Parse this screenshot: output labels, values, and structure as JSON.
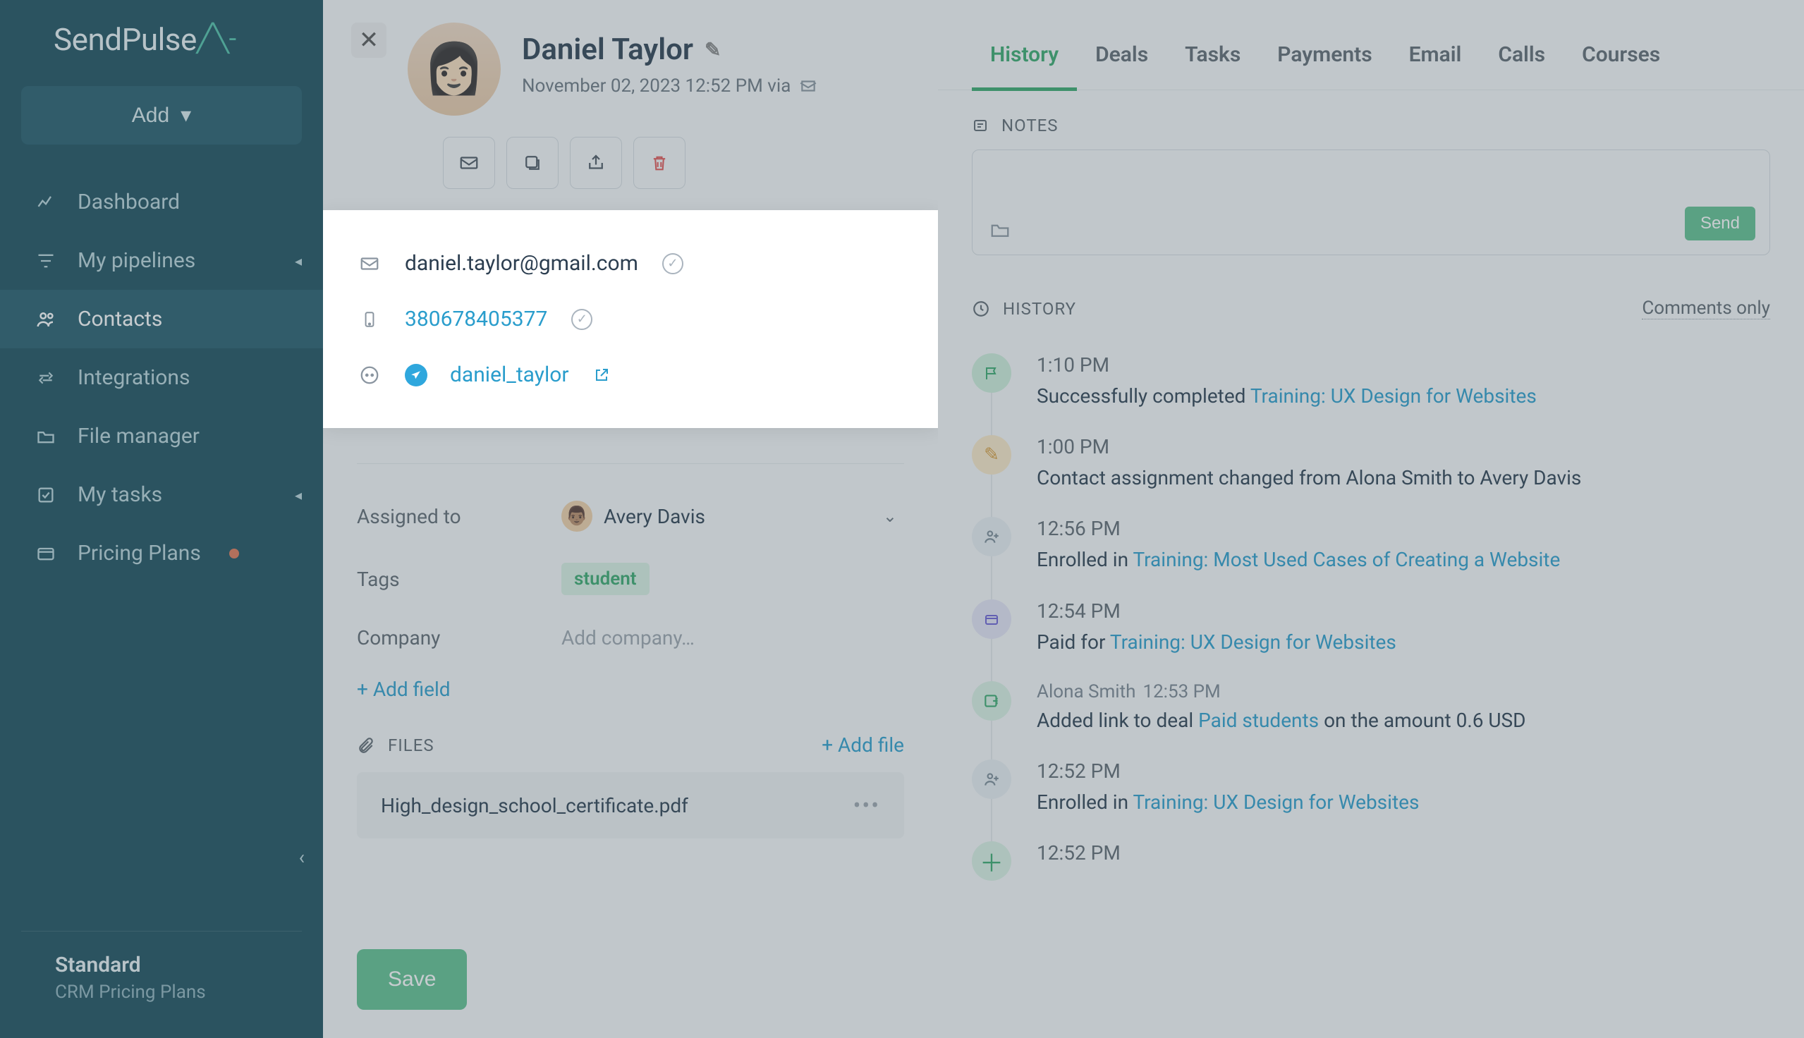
{
  "brand": "SendPulse",
  "sidebar": {
    "add_label": "Add",
    "items": [
      {
        "label": "Dashboard"
      },
      {
        "label": "My pipelines"
      },
      {
        "label": "Contacts"
      },
      {
        "label": "Integrations"
      },
      {
        "label": "File manager"
      },
      {
        "label": "My tasks"
      },
      {
        "label": "Pricing Plans"
      }
    ],
    "plan_name": "Standard",
    "plan_sub": "CRM Pricing Plans"
  },
  "contact": {
    "name": "Daniel Taylor",
    "created": "November 02, 2023 12:52 PM via",
    "email": "daniel.taylor@gmail.com",
    "phone": "380678405377",
    "telegram": "daniel_taylor",
    "assigned_label": "Assigned to",
    "assigned_to": "Avery Davis",
    "tags_label": "Tags",
    "tag": "student",
    "company_label": "Company",
    "company_placeholder": "Add company…",
    "add_field": "+ Add field",
    "files_label": "FILES",
    "add_file": "+ Add file",
    "file_name": "High_design_school_certificate.pdf",
    "save": "Save"
  },
  "right": {
    "tabs": [
      "History",
      "Deals",
      "Tasks",
      "Payments",
      "Email",
      "Calls",
      "Courses"
    ],
    "notes_label": "NOTES",
    "send": "Send",
    "history_label": "HISTORY",
    "comments_only": "Comments only",
    "timeline": [
      {
        "time": "1:10 PM",
        "prefix": "Successfully completed ",
        "link": "Training: UX Design for Websites",
        "suffix": "",
        "icon": "flag"
      },
      {
        "time": "1:00 PM",
        "text": "Contact assignment changed from Alona Smith to Avery Davis",
        "icon": "pencil"
      },
      {
        "time": "12:56 PM",
        "prefix": "Enrolled in ",
        "link": "Training: Most Used Cases of Creating a Website",
        "suffix": "",
        "icon": "enroll"
      },
      {
        "time": "12:54 PM",
        "prefix": "Paid for ",
        "link": "Training: UX Design for Websites",
        "suffix": "",
        "icon": "pay"
      },
      {
        "meta_name": "Alona Smith",
        "meta_time": "12:53 PM",
        "prefix": "Added link to deal ",
        "link": "Paid students",
        "suffix": " on the amount 0.6 USD",
        "icon": "link"
      },
      {
        "time": "12:52 PM",
        "prefix": "Enrolled in ",
        "link": "Training: UX Design for Websites",
        "suffix": "",
        "icon": "enroll"
      },
      {
        "time": "12:52 PM",
        "icon": "plus"
      }
    ]
  }
}
